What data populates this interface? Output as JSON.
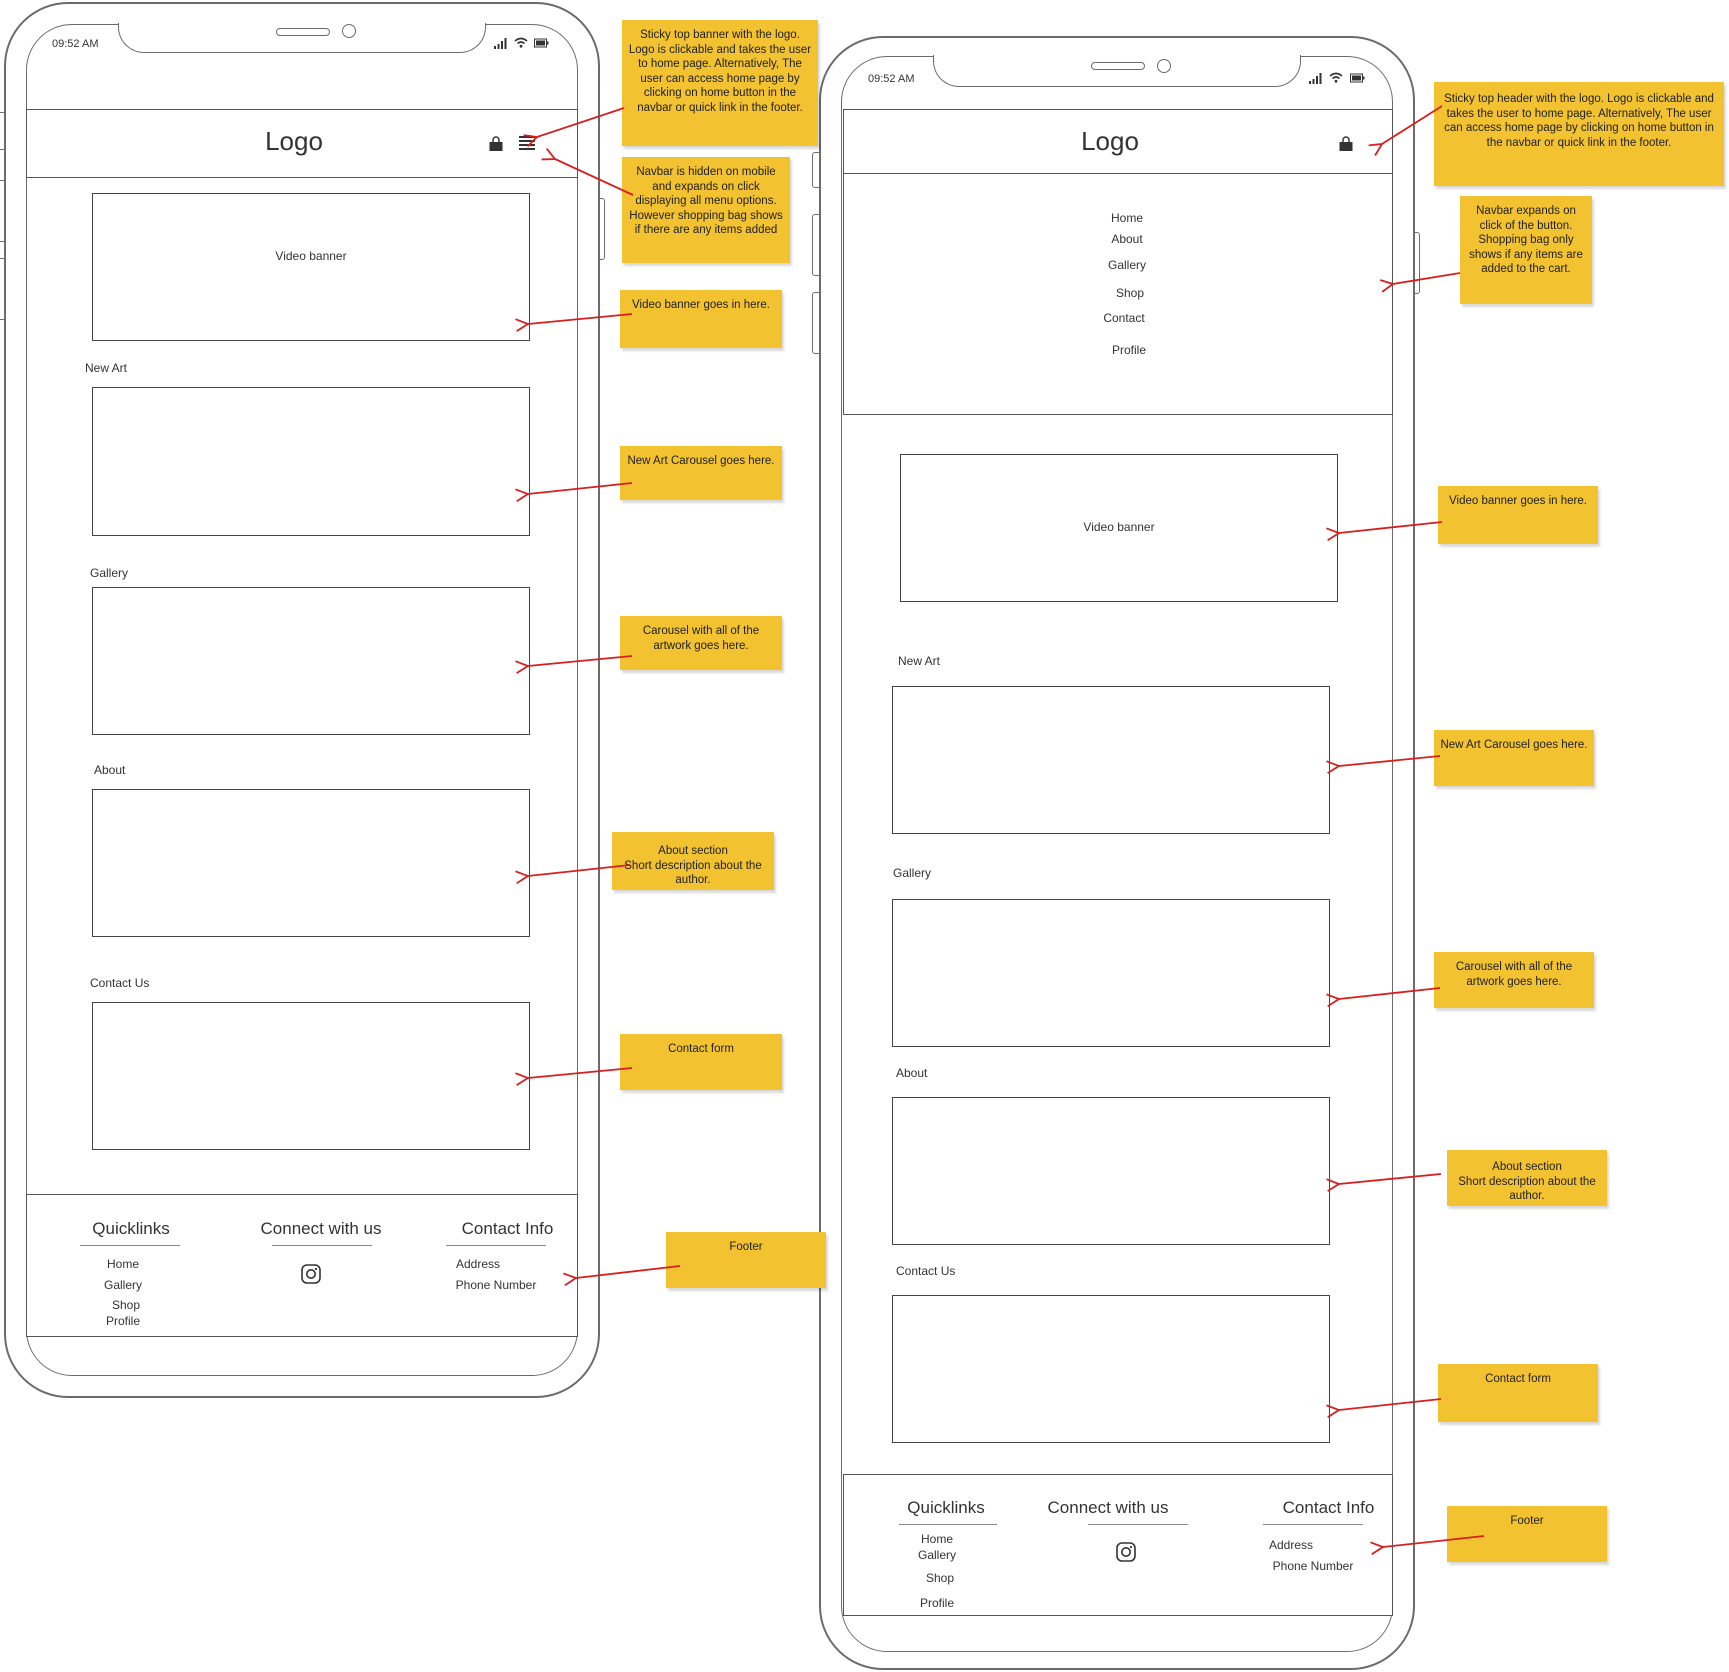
{
  "colors": {
    "note_bg": "#f2c230",
    "arrow": "#d62020",
    "outline": "#6b6b6b"
  },
  "status_time": "09:52 AM",
  "logo": "Logo",
  "icons": [
    "shopping-bag-icon",
    "hamburger-menu-icon",
    "instagram-icon",
    "signal-icon",
    "wifi-icon",
    "battery-icon"
  ],
  "mobile_collapsed": {
    "video_banner": "Video banner",
    "sections": [
      "New Art",
      "Gallery",
      "About",
      "Contact Us"
    ]
  },
  "mobile_expanded": {
    "nav_links": [
      "Home",
      "About",
      "Gallery",
      "Shop",
      "Contact",
      "Profile"
    ],
    "video_banner": "Video banner",
    "sections": [
      "New Art",
      "Gallery",
      "About",
      "Contact Us"
    ]
  },
  "footer": {
    "quicklinks_title": "Quicklinks",
    "quicklinks": [
      "Home",
      "Gallery",
      "Shop",
      "Profile"
    ],
    "connect_title": "Connect with us",
    "contact_title": "Contact Info",
    "contact_items": [
      "Address",
      "Phone Number"
    ]
  },
  "notes_left": {
    "header": "Sticky top banner with the logo. Logo is clickable and takes the user to home page. Alternatively, The user can access home page by clicking on home button in the navbar or quick link in the footer.",
    "navbar": "Navbar is hidden on mobile and expands on click displaying all menu options. However shopping bag shows if there are any items added",
    "video": "Video banner goes in here.",
    "new_art": "New Art Carousel goes here.",
    "gallery": "Carousel with all of the artwork goes here.",
    "about_line1": "About section",
    "about_line2": "Short description about the author.",
    "contact": "Contact form",
    "footer": "Footer"
  },
  "notes_right": {
    "header": "Sticky top header with the logo. Logo is clickable and takes the user to home page. Alternatively, The user can access home page by clicking on home button in the navbar or quick link in the footer.",
    "navbar": "Navbar expands on click of the button. Shopping bag only shows if any items are added to the cart.",
    "video": "Video banner goes in here.",
    "new_art": "New Art Carousel goes here.",
    "gallery": "Carousel with all of the artwork goes here.",
    "about_line1": "About section",
    "about_line2": "Short description about the author.",
    "contact": "Contact form",
    "footer": "Footer"
  }
}
